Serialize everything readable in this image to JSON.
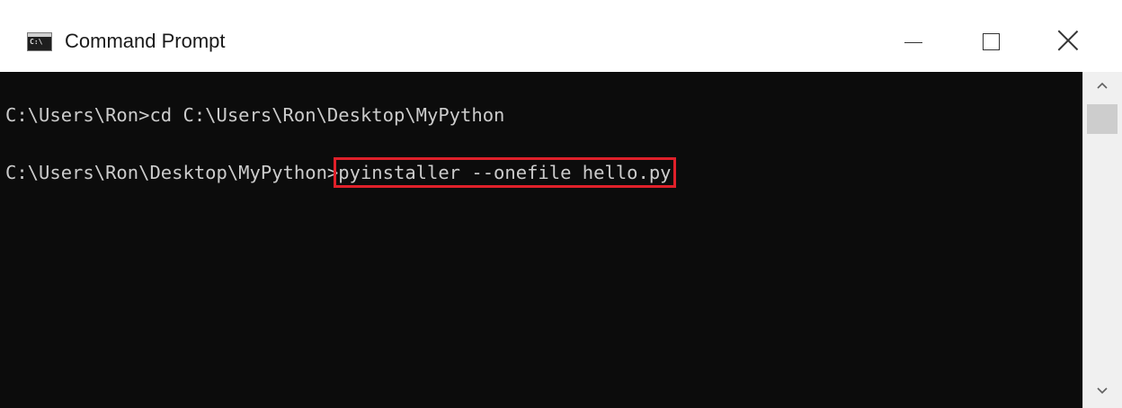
{
  "window": {
    "title": "Command Prompt",
    "icon": "cmd-icon",
    "icon_label": "C:\\",
    "controls": [
      "minimize-icon",
      "maximize-icon",
      "close-icon"
    ]
  },
  "console": {
    "line1": "C:\\Users\\Ron>cd C:\\Users\\Ron\\Desktop\\MyPython",
    "line2_prompt": "C:\\Users\\Ron\\Desktop\\MyPython>",
    "line2_command": "pyinstaller --onefile hello.py",
    "highlight_color": "#e0202a",
    "text_color": "#cccccc",
    "background": "#0c0c0c"
  },
  "scrollbar": {
    "up_icon": "chevron-up-icon",
    "down_icon": "chevron-down-icon"
  }
}
